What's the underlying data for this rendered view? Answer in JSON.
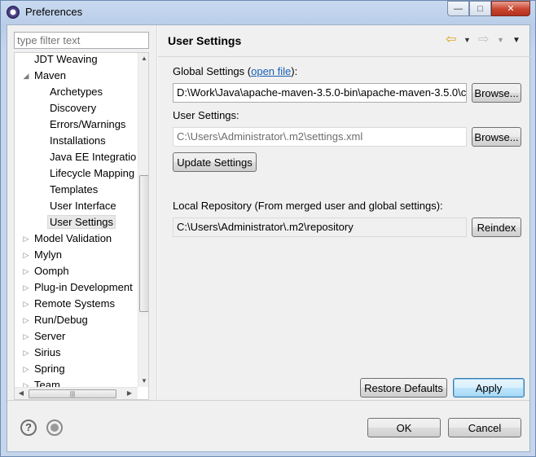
{
  "window": {
    "title": "Preferences",
    "controls": {
      "minimize": "—",
      "maximize": "□",
      "close": "✕"
    }
  },
  "filter": {
    "placeholder": "type filter text"
  },
  "tree": {
    "items": [
      {
        "label": "JDT Weaving",
        "level": 1,
        "toggle": ""
      },
      {
        "label": "Maven",
        "level": 1,
        "toggle": "◢"
      },
      {
        "label": "Archetypes",
        "level": 2,
        "toggle": ""
      },
      {
        "label": "Discovery",
        "level": 2,
        "toggle": ""
      },
      {
        "label": "Errors/Warnings",
        "level": 2,
        "toggle": ""
      },
      {
        "label": "Installations",
        "level": 2,
        "toggle": ""
      },
      {
        "label": "Java EE Integratio",
        "level": 2,
        "toggle": ""
      },
      {
        "label": "Lifecycle Mapping",
        "level": 2,
        "toggle": ""
      },
      {
        "label": "Templates",
        "level": 2,
        "toggle": ""
      },
      {
        "label": "User Interface",
        "level": 2,
        "toggle": ""
      },
      {
        "label": "User Settings",
        "level": 2,
        "toggle": "",
        "selected": true
      },
      {
        "label": "Model Validation",
        "level": 1,
        "toggle": "▷"
      },
      {
        "label": "Mylyn",
        "level": 1,
        "toggle": "▷"
      },
      {
        "label": "Oomph",
        "level": 1,
        "toggle": "▷"
      },
      {
        "label": "Plug-in Development",
        "level": 1,
        "toggle": "▷"
      },
      {
        "label": "Remote Systems",
        "level": 1,
        "toggle": "▷"
      },
      {
        "label": "Run/Debug",
        "level": 1,
        "toggle": "▷"
      },
      {
        "label": "Server",
        "level": 1,
        "toggle": "▷"
      },
      {
        "label": "Sirius",
        "level": 1,
        "toggle": "▷"
      },
      {
        "label": "Spring",
        "level": 1,
        "toggle": "▷"
      },
      {
        "label": "Team",
        "level": 1,
        "toggle": "▷"
      }
    ]
  },
  "page": {
    "title": "User Settings",
    "global_settings_label_pre": "Global Settings (",
    "open_file_link": "open file",
    "global_settings_label_post": "):",
    "global_settings_value": "D:\\Work\\Java\\apache-maven-3.5.0-bin\\apache-maven-3.5.0\\c",
    "browse_label": "Browse...",
    "user_settings_label": "User Settings:",
    "user_settings_value": "C:\\Users\\Administrator\\.m2\\settings.xml",
    "update_settings_label": "Update Settings",
    "local_repo_label": "Local Repository (From merged user and global settings):",
    "local_repo_value": "C:\\Users\\Administrator\\.m2\\repository",
    "reindex_label": "Reindex",
    "restore_defaults_label": "Restore Defaults",
    "apply_label": "Apply"
  },
  "footer": {
    "help_symbol": "?",
    "ok_label": "OK",
    "cancel_label": "Cancel"
  },
  "icons": {
    "back": "⇦",
    "forward": "⇨",
    "dropdown": "▼"
  }
}
